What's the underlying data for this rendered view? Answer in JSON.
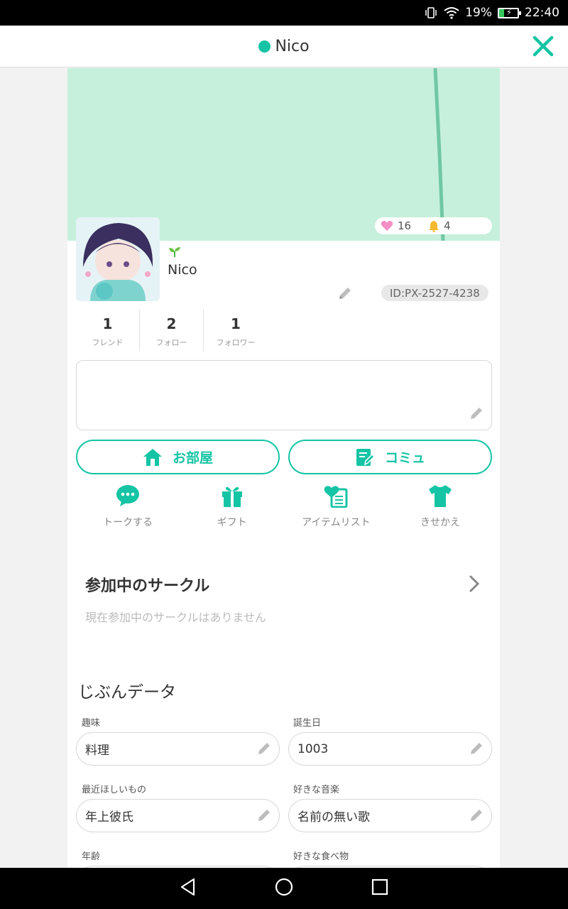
{
  "status_bar": {
    "battery": "19%",
    "time": "22:40"
  },
  "header": {
    "title": "Nico"
  },
  "profile": {
    "likes": "16",
    "notifications": "4",
    "name": "Nico",
    "id": "ID:PX-2527-4238"
  },
  "counts": [
    {
      "value": "1",
      "label": "フレンド"
    },
    {
      "value": "2",
      "label": "フォロー"
    },
    {
      "value": "1",
      "label": "フォロワー"
    }
  ],
  "buttons": {
    "room": "お部屋",
    "commu": "コミュ"
  },
  "actions": [
    {
      "label": "トークする"
    },
    {
      "label": "ギフト"
    },
    {
      "label": "アイテムリスト"
    },
    {
      "label": "きせかえ"
    }
  ],
  "circle": {
    "title": "参加中のサークル",
    "empty": "現在参加中のサークルはありません"
  },
  "data": {
    "title": "じぶんデータ",
    "fields": [
      {
        "label": "趣味",
        "value": "料理"
      },
      {
        "label": "誕生日",
        "value": "1003"
      },
      {
        "label": "最近ほしいもの",
        "value": "年上彼氏"
      },
      {
        "label": "好きな音楽",
        "value": "名前の無い歌"
      },
      {
        "label": "年齢",
        "value": ""
      },
      {
        "label": "好きな食べ物",
        "value": ""
      }
    ]
  },
  "colors": {
    "accent": "#14c4a4",
    "cover": "#c6f0dc"
  }
}
